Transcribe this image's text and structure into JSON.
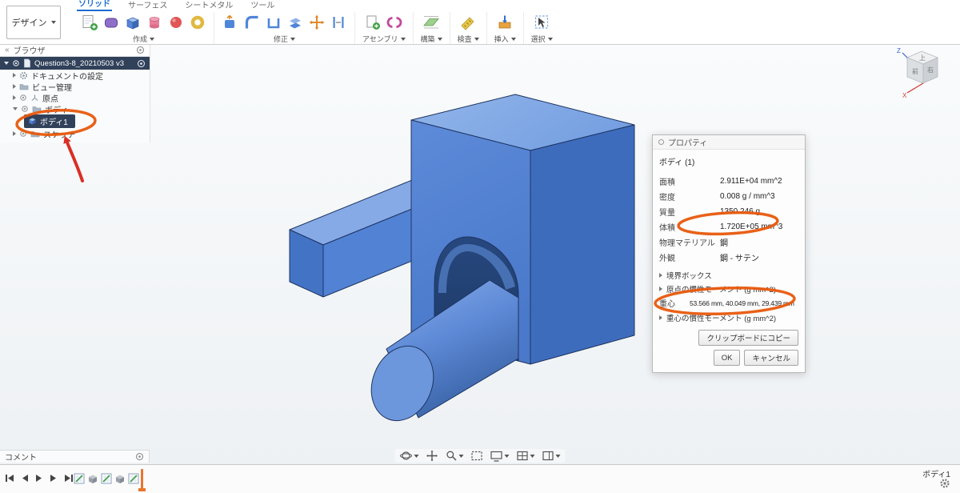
{
  "colors": {
    "body_blue": "#4f7fd0",
    "annotation_orange": "#e8590c",
    "annotation_red": "#d93025",
    "active_tab_blue": "#1a6dd0",
    "selected_row_bg": "#31415a"
  },
  "header": {
    "design_menu_label": "デザイン",
    "tabs": [
      {
        "label": "ソリッド",
        "active": true
      },
      {
        "label": "サーフェス",
        "active": false
      },
      {
        "label": "シートメタル",
        "active": false
      },
      {
        "label": "ツール",
        "active": false
      }
    ],
    "groups": [
      {
        "label": "作成",
        "icons": [
          "create-sketch-icon",
          "create-form-icon",
          "box-icon",
          "cylinder-icon",
          "sphere-icon",
          "torus-icon"
        ]
      },
      {
        "label": "修正",
        "icons": [
          "press-pull-icon",
          "fillet-icon",
          "shell-icon",
          "combine-icon",
          "move-icon",
          "align-icon"
        ]
      },
      {
        "label": "アセンブリ",
        "icons": [
          "new-component-icon",
          "joint-icon"
        ]
      },
      {
        "label": "構築",
        "icons": [
          "construction-plane-icon"
        ]
      },
      {
        "label": "検査",
        "icons": [
          "measure-icon"
        ]
      },
      {
        "label": "挿入",
        "icons": [
          "insert-icon"
        ]
      },
      {
        "label": "選択",
        "icons": [
          "select-icon"
        ]
      }
    ]
  },
  "browser": {
    "title": "ブラウザ",
    "root_label": "Question3-8_20210503 v3",
    "items": [
      {
        "label": "ドキュメントの設定",
        "icon": "gear-icon"
      },
      {
        "label": "ビュー管理",
        "icon": "folder-icon"
      },
      {
        "label": "原点",
        "icon": "eye-icon"
      },
      {
        "label": "ボディ",
        "icon": "folder-icon"
      },
      {
        "label": "ボディ1",
        "icon": "body-cube-icon",
        "selected": true
      },
      {
        "label": "スケッチ",
        "icon": "folder-icon"
      }
    ]
  },
  "dialog": {
    "title": "プロパティ",
    "subtitle": "ボディ (1)",
    "rows": [
      {
        "label": "面積",
        "value": "2.911E+04 mm^2"
      },
      {
        "label": "密度",
        "value": "0.008 g / mm^3"
      },
      {
        "label": "質量",
        "value": "1350.246 g"
      },
      {
        "label": "体積",
        "value": "1.720E+05 mm^3",
        "highlighted": true
      },
      {
        "label": "物理マテリアル",
        "value": "鋼"
      },
      {
        "label": "外観",
        "value": "鋼 - サテン"
      }
    ],
    "sections": [
      "境界ボックス",
      "原点の慣性モーメント  (g mm^2)",
      "重心の慣性モーメント  (g mm^2)"
    ],
    "centroid": {
      "label": "重心",
      "value": "53.566 mm, 40.049 mm, 29.439 mm",
      "highlighted": true
    },
    "copy_button_label": "クリップボードにコピー",
    "ok_label": "OK",
    "cancel_label": "キャンセル"
  },
  "viewcube": {
    "top": "上",
    "front": "前",
    "right": "右",
    "x_axis": "X",
    "z_axis": "Z"
  },
  "comment_panel": {
    "title": "コメント"
  },
  "footer": {
    "selection_label": "ボディ1"
  },
  "navbar": {
    "icons": [
      "orbit-icon",
      "pan-icon",
      "zoom-icon",
      "fit-icon",
      "display-settings-icon",
      "grid-layout-icon",
      "viewports-icon"
    ]
  },
  "timeline": {
    "features": [
      "sketch-icon",
      "body-feature-icon",
      "sketch-icon",
      "body-feature-icon",
      "sketch-icon"
    ]
  }
}
